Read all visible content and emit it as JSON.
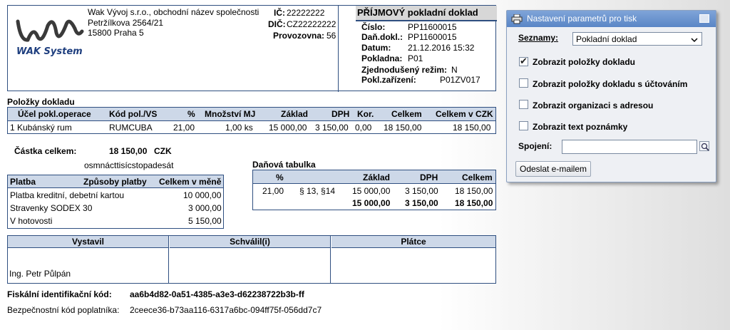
{
  "company": {
    "logo_text": "WAK System",
    "name": "Wak Vývoj s.r.o., obchodní název společnosti",
    "street": "Petržílkova 2564/21",
    "city": "15800 Praha 5",
    "ic_label": "IČ:",
    "ic_value": "22222222",
    "dic_label": "DIČ:",
    "dic_value": "CZ22222222",
    "provozovna_label": "Provozovna:",
    "provozovna_value": "56"
  },
  "document": {
    "title": "PŘÍJMOVÝ pokladní doklad",
    "fields": [
      {
        "label": "Číslo:",
        "value": "PP11600015"
      },
      {
        "label": "Daň.dokl.:",
        "value": "PP11600015"
      },
      {
        "label": "Datum:",
        "value": "21.12.2016 15:32"
      },
      {
        "label": "Pokladna:",
        "value": "P01"
      },
      {
        "label": "Zjednodušený režim:",
        "value": "N"
      },
      {
        "label": "Pokl.zařízení:",
        "value": "P01ZV017"
      }
    ]
  },
  "items": {
    "section_title": "Položky dokladu",
    "headers": [
      "Účel pokl.operace",
      "Kód pol./VS",
      "%",
      "Množství MJ",
      "Základ",
      "DPH",
      "Kor.",
      "Celkem",
      "Celkem v CZK"
    ],
    "rows": [
      [
        "1  Kubánský rum",
        "RUMCUBA",
        "21,00",
        "1,00 ks",
        "15 000,00",
        "3 150,00",
        "0,00",
        "18 150,00",
        "18 150,00"
      ]
    ]
  },
  "total": {
    "label": "Částka celkem:",
    "value": "18 150,00",
    "currency": "CZK",
    "words": "osmnácttisícstopadesát"
  },
  "payments": {
    "headers": [
      "Platba",
      "Způsoby platby",
      "Celkem v měně"
    ],
    "rows": [
      {
        "name": "Platba kreditní, debetní kartou",
        "amount": "10 000,00"
      },
      {
        "name": "Stravenky SODEX 30",
        "amount": "3 000,00"
      },
      {
        "name": "V hotovosti",
        "amount": "5 150,00"
      }
    ]
  },
  "tax": {
    "section_title": "Daňová tabulka",
    "headers": [
      "%",
      "Základ",
      "DPH",
      "Celkem"
    ],
    "rows": [
      {
        "pct": "21,00",
        "para": "§ 13, §14",
        "base": "15 000,00",
        "vat": "3 150,00",
        "total": "18 150,00"
      }
    ],
    "sum": {
      "base": "15 000,00",
      "vat": "3 150,00",
      "total": "18 150,00"
    }
  },
  "signatures": {
    "headers": [
      "Vystavil",
      "Schválil(i)",
      "Plátce"
    ],
    "issued_by": "Ing. Petr Půlpán"
  },
  "fiscal": {
    "fik_label": "Fiskální identifikační kód:",
    "fik_value": "aa6b4d82-0a51-4385-a3e3-d62238722b3b-ff",
    "bkp_label": "Bezpečnostní kód poplatníka:",
    "bkp_value": "2ceece36-b73aa116-6317a6bc-094ff75f-056dd7c7"
  },
  "panel": {
    "title": "Nastavení parametrů pro tisk",
    "lists_label": "Seznamy:",
    "lists_value": "Pokladní doklad",
    "options": [
      {
        "label": "Zobrazit položky dokladu",
        "checked": true
      },
      {
        "label": "Zobrazit položky dokladu s účtováním",
        "checked": false
      },
      {
        "label": "Zobrazit organizaci s adresou",
        "checked": false
      },
      {
        "label": "Zobrazit text poznámky",
        "checked": false
      }
    ],
    "connection_label": "Spojení:",
    "connection_value": "",
    "email_button": "Odeslat e-mailem"
  }
}
